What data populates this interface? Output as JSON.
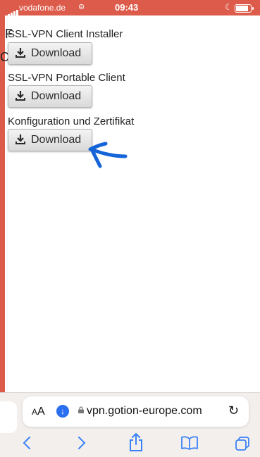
{
  "status_bar": {
    "carrier": "vodafone.de",
    "time": "09:43"
  },
  "page": {
    "stray_letters": [
      "F",
      "C"
    ],
    "sections": [
      {
        "title": "SSL-VPN Client Installer",
        "button_label": "Download"
      },
      {
        "title": "SSL-VPN Portable Client",
        "button_label": "Download"
      },
      {
        "title": "Konfiguration und Zertifikat",
        "button_label": "Download"
      }
    ]
  },
  "address_bar": {
    "text_size_label": "AA",
    "url": "vpn.gotion-europe.com"
  },
  "colors": {
    "status_bar_bg": "#dd5b4a",
    "toolbar_icon": "#3b82f6",
    "annotation_arrow": "#1565d8"
  }
}
